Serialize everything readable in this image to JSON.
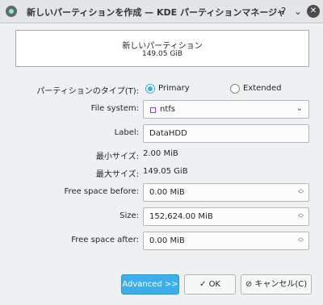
{
  "window": {
    "title": "新しいパーティションを作成 — KDE パーティションマネージャ",
    "help_glyph": "?",
    "minimize_glyph": "⌄",
    "close_glyph": "✕"
  },
  "preview": {
    "name": "新しいパーティション",
    "size": "149.05 GiB"
  },
  "form": {
    "partition_type_label": "パーティションのタイプ(T):",
    "type_options": [
      {
        "label": "Primary",
        "selected": true
      },
      {
        "label": "Extended",
        "selected": false
      }
    ],
    "file_system_label": "File system:",
    "file_system_value": "ntfs",
    "label_label": "Label:",
    "label_value": "DataHDD",
    "min_size_label": "最小サイズ:",
    "min_size_value": "2.00 MiB",
    "max_size_label": "最大サイズ:",
    "max_size_value": "149.05 GiB",
    "free_before_label": "Free space before:",
    "free_before_value": "0.00 MiB",
    "size_label": "Size:",
    "size_value": "152,624.00 MiB",
    "free_after_label": "Free space after:",
    "free_after_value": "0.00 MiB"
  },
  "buttons": {
    "advanced": "Advanced >>",
    "ok": "OK",
    "cancel": "キャンセル(C)"
  },
  "colors": {
    "accent": "#3daee9",
    "fs_color": "#8e44ad"
  }
}
